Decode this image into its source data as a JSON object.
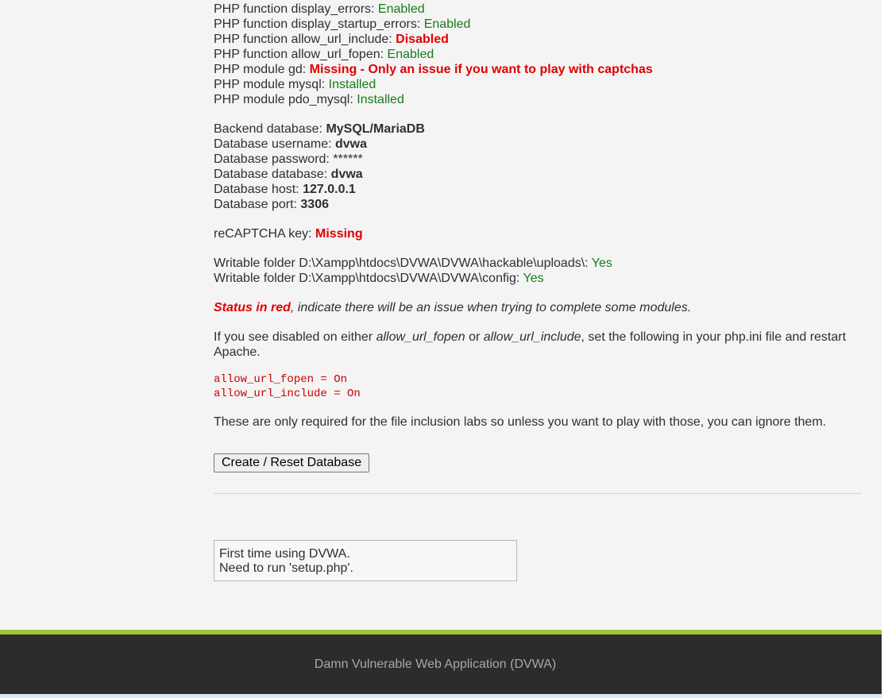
{
  "php_checks": [
    {
      "label": "PHP function display_errors: ",
      "status": "Enabled",
      "kind": "ok"
    },
    {
      "label": "PHP function display_startup_errors: ",
      "status": "Enabled",
      "kind": "ok"
    },
    {
      "label": "PHP function allow_url_include: ",
      "status": "Disabled",
      "kind": "bad"
    },
    {
      "label": "PHP function allow_url_fopen: ",
      "status": "Enabled",
      "kind": "ok"
    },
    {
      "label": "PHP module gd: ",
      "status": "Missing - Only an issue if you want to play with captchas",
      "kind": "bad"
    },
    {
      "label": "PHP module mysql: ",
      "status": "Installed",
      "kind": "ok"
    },
    {
      "label": "PHP module pdo_mysql: ",
      "status": "Installed",
      "kind": "ok"
    }
  ],
  "database": {
    "backend_label": "Backend database: ",
    "backend_value": "MySQL/MariaDB",
    "username_label": "Database username: ",
    "username_value": "dvwa",
    "password_label": "Database password: ",
    "password_value": "******",
    "database_label": "Database database: ",
    "database_value": "dvwa",
    "host_label": "Database host: ",
    "host_value": "127.0.0.1",
    "port_label": "Database port: ",
    "port_value": "3306"
  },
  "recaptcha": {
    "label": "reCAPTCHA key: ",
    "value": "Missing"
  },
  "folders": [
    {
      "label": "Writable folder D:\\Xampp\\htdocs\\DVWA\\DVWA\\hackable\\uploads\\: ",
      "status": "Yes"
    },
    {
      "label": "Writable folder D:\\Xampp\\htdocs\\DVWA\\DVWA\\config: ",
      "status": "Yes"
    }
  ],
  "status_note": {
    "red": "Status in red",
    "rest": ", indicate there will be an issue when trying to complete some modules."
  },
  "instructions": {
    "part1": "If you see disabled on either ",
    "fopen": "allow_url_fopen",
    "or": " or ",
    "include": "allow_url_include",
    "part2": ", set the following in your php.ini file and restart Apache."
  },
  "code_lines": [
    "allow_url_fopen = On",
    "allow_url_include = On"
  ],
  "inclusion_note": "These are only required for the file inclusion labs so unless you want to play with those, you can ignore them.",
  "button_label": "Create / Reset Database",
  "message": {
    "line1": "First time using DVWA.",
    "line2": "Need to run 'setup.php'."
  },
  "footer": {
    "text": "Damn Vulnerable Web Application (DVWA)"
  },
  "colors": {
    "ok": "#1a7a1a",
    "bad": "#e00000",
    "footer_bg": "#2c2c2c",
    "footer_accent": "#9ec53c"
  }
}
